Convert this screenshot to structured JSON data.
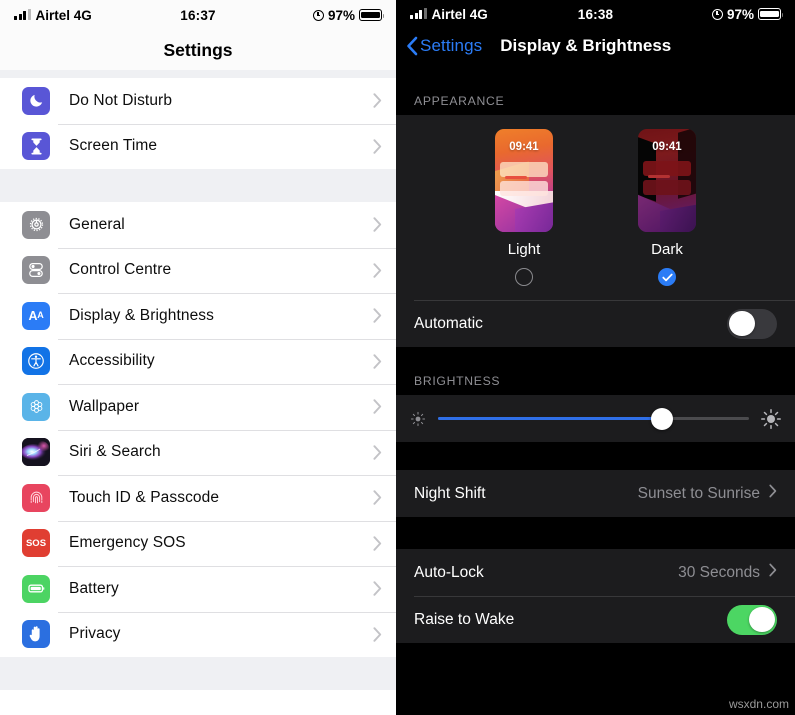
{
  "left_phone": {
    "status_bar": {
      "carrier": "Airtel 4G",
      "time": "16:37",
      "battery_percent": "97%",
      "signal_icon": "signal-bars-icon",
      "alarm_icon": "alarm-clock-icon",
      "battery_icon": "battery-icon"
    },
    "nav": {
      "title": "Settings"
    },
    "groups": [
      {
        "items": [
          {
            "label": "Do Not Disturb",
            "icon": "moon-icon",
            "icon_color": "#5956d6",
            "chevron": "chevron-right-icon"
          },
          {
            "label": "Screen Time",
            "icon": "hourglass-icon",
            "icon_color": "#5956d6",
            "chevron": "chevron-right-icon"
          }
        ]
      },
      {
        "items": [
          {
            "label": "General",
            "icon": "gear-icon",
            "icon_color": "#8e8e93",
            "chevron": "chevron-right-icon"
          },
          {
            "label": "Control Centre",
            "icon": "sliders-toggle-icon",
            "icon_color": "#8e8e93",
            "chevron": "chevron-right-icon"
          },
          {
            "label": "Display & Brightness",
            "icon": "aa-text-icon",
            "icon_color": "#2b7cf6",
            "chevron": "chevron-right-icon"
          },
          {
            "label": "Accessibility",
            "icon": "accessibility-person-icon",
            "icon_color": "#1273e6",
            "chevron": "chevron-right-icon"
          },
          {
            "label": "Wallpaper",
            "icon": "flower-wallpaper-icon",
            "icon_color": "#5ab4e8",
            "chevron": "chevron-right-icon"
          },
          {
            "label": "Siri & Search",
            "icon": "siri-orb-icon",
            "icon_color": "#1b1b2b",
            "chevron": "chevron-right-icon"
          },
          {
            "label": "Touch ID & Passcode",
            "icon": "fingerprint-icon",
            "icon_color": "#e8455f",
            "chevron": "chevron-right-icon"
          },
          {
            "label": "Emergency SOS",
            "icon": "sos-icon",
            "icon_color": "#e03e32",
            "chevron": "chevron-right-icon"
          },
          {
            "label": "Battery",
            "icon": "battery-icon",
            "icon_color": "#4cd463",
            "chevron": "chevron-right-icon"
          },
          {
            "label": "Privacy",
            "icon": "hand-raised-icon",
            "icon_color": "#2b6fe0",
            "chevron": "chevron-right-icon"
          }
        ]
      }
    ]
  },
  "right_phone": {
    "status_bar": {
      "carrier": "Airtel 4G",
      "time": "16:38",
      "battery_percent": "97%",
      "signal_icon": "signal-bars-icon",
      "alarm_icon": "alarm-clock-icon",
      "battery_icon": "battery-icon"
    },
    "nav": {
      "back_label": "Settings",
      "back_icon": "chevron-left-icon",
      "title": "Display & Brightness"
    },
    "appearance": {
      "section_header": "APPEARANCE",
      "options": [
        {
          "caption": "Light",
          "preview_time": "09:41",
          "selected": false
        },
        {
          "caption": "Dark",
          "preview_time": "09:41",
          "selected": true
        }
      ],
      "automatic": {
        "label": "Automatic",
        "state": "off"
      }
    },
    "brightness": {
      "section_header": "BRIGHTNESS",
      "slider_value_percent": 72,
      "low_icon": "brightness-low-icon",
      "high_icon": "brightness-high-icon",
      "track_fill_color": "#2f6fe8"
    },
    "night_shift": {
      "label": "Night Shift",
      "value": "Sunset to Sunrise",
      "chevron": "chevron-right-icon"
    },
    "auto_lock": {
      "label": "Auto-Lock",
      "value": "30 Seconds",
      "chevron": "chevron-right-icon"
    },
    "raise_to_wake": {
      "label": "Raise to Wake",
      "state": "on"
    }
  },
  "watermark": "wsxdn.com"
}
